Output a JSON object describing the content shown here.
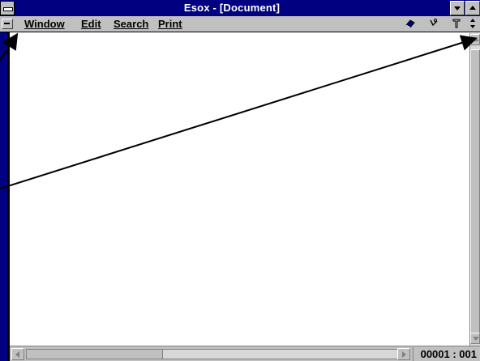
{
  "window": {
    "title": "Esox - [Document]"
  },
  "menu": {
    "items": [
      {
        "label": "Window",
        "mnemonic": "W"
      },
      {
        "label": "Edit",
        "mnemonic": "E"
      },
      {
        "label": "Search",
        "mnemonic": "S"
      },
      {
        "label": "Print",
        "mnemonic": "P"
      }
    ]
  },
  "toolbar": {
    "icons": [
      "eraser-icon",
      "check-icon",
      "tool-icon"
    ]
  },
  "status": {
    "position": "00001 : 001"
  },
  "colors": {
    "title_bar": "#000080",
    "chrome": "#c0c0c0",
    "content_bg": "#ffffff"
  }
}
